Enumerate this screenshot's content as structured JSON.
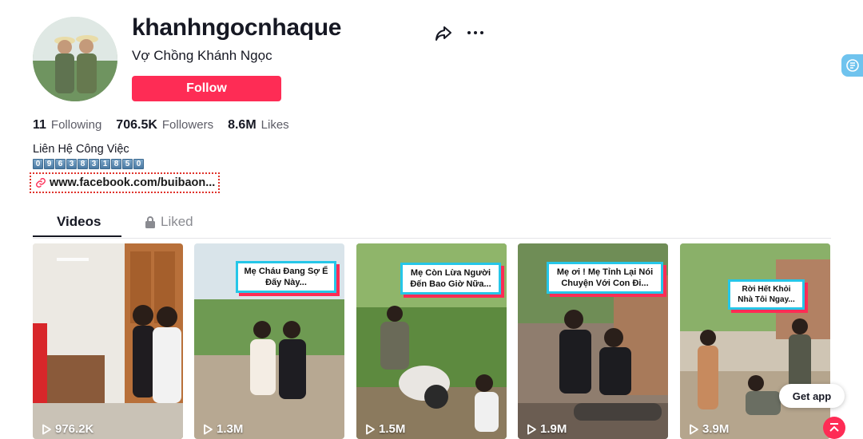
{
  "profile": {
    "username": "khanhngocnhaque",
    "nickname": "Vợ Chồng Khánh Ngọc",
    "follow_label": "Follow",
    "avatar_icon": "avatar-couple-photo"
  },
  "stats": [
    {
      "value": "11",
      "label": "Following"
    },
    {
      "value": "706.5K",
      "label": "Followers"
    },
    {
      "value": "8.6M",
      "label": "Likes"
    }
  ],
  "bio": {
    "line1": "Liên Hệ Công Việc",
    "phone_digits": [
      "0",
      "9",
      "6",
      "3",
      "8",
      "3",
      "1",
      "8",
      "5",
      "0"
    ],
    "link_text": "www.facebook.com/buibaon..."
  },
  "actions": {
    "share_icon": "share-icon",
    "more_icon": "more-icon"
  },
  "tabs": {
    "videos": "Videos",
    "liked": "Liked"
  },
  "videos": [
    {
      "views": "976.2K",
      "caption": ""
    },
    {
      "views": "1.3M",
      "caption": "Mẹ Cháu Đang Sợ Ế Đấy Này..."
    },
    {
      "views": "1.5M",
      "caption": "Mẹ Còn Lừa Người Đến Bao Giờ Nữa..."
    },
    {
      "views": "1.9M",
      "caption": "Mẹ ơi ! Mẹ Tỉnh Lại Nói Chuyện Với Con Đi..."
    },
    {
      "views": "3.9M",
      "caption": "Rời Hết Khỏi Nhà Tôi Ngay..."
    }
  ],
  "floating": {
    "get_app": "Get app"
  },
  "colors": {
    "accent": "#fe2c55",
    "caption_border": "#25c6e8",
    "text": "#161823",
    "muted": "#8a8b91"
  }
}
